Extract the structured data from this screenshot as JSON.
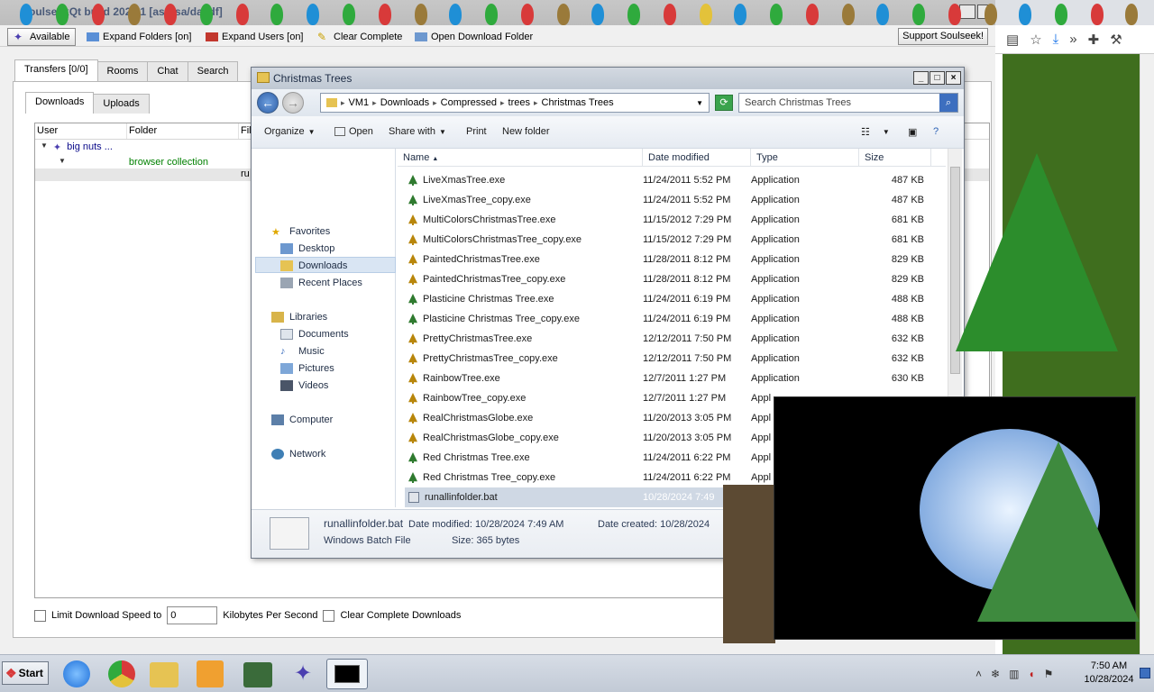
{
  "soulseek": {
    "title": "SoulseekQt build 2024.1 [asdfsa/dasdf]",
    "toolbar": {
      "available": "Available",
      "expand_folders": "Expand Folders [on]",
      "expand_users": "Expand Users [on]",
      "clear_complete": "Clear Complete",
      "open_download_folder": "Open Download Folder",
      "support": "Support Soulseek!"
    },
    "tabs": [
      "Transfers [0/0]",
      "Rooms",
      "Chat",
      "Search"
    ],
    "subtabs": [
      "Downloads",
      "Uploads"
    ],
    "columns": [
      "User",
      "Folder",
      "Fil"
    ],
    "rows": {
      "user": "big nuts ...",
      "folder": "browser collection",
      "file_fragment": "ru"
    },
    "bottom": {
      "limit_label": "Limit Download Speed to",
      "speed_value": "0",
      "units": "Kilobytes Per Second",
      "clear_label": "Clear Complete Downloads"
    }
  },
  "explorer": {
    "title": "Christmas Trees",
    "breadcrumb": [
      "VM1",
      "Downloads",
      "Compressed",
      "trees",
      "Christmas Trees"
    ],
    "search_placeholder": "Search Christmas Trees",
    "commands": {
      "organize": "Organize",
      "open": "Open",
      "share_with": "Share with",
      "print": "Print",
      "new_folder": "New folder"
    },
    "nav": {
      "favorites": "Favorites",
      "desktop": "Desktop",
      "downloads": "Downloads",
      "recent": "Recent Places",
      "libraries": "Libraries",
      "documents": "Documents",
      "music": "Music",
      "pictures": "Pictures",
      "videos": "Videos",
      "computer": "Computer",
      "network": "Network"
    },
    "columns": {
      "name": "Name",
      "date": "Date modified",
      "type": "Type",
      "size": "Size"
    },
    "files": [
      {
        "name": "LiveXmasTree.exe",
        "date": "11/24/2011 5:52 PM",
        "type": "Application",
        "size": "487 KB"
      },
      {
        "name": "LiveXmasTree_copy.exe",
        "date": "11/24/2011 5:52 PM",
        "type": "Application",
        "size": "487 KB"
      },
      {
        "name": "MultiColorsChristmasTree.exe",
        "date": "11/15/2012 7:29 PM",
        "type": "Application",
        "size": "681 KB"
      },
      {
        "name": "MultiColorsChristmasTree_copy.exe",
        "date": "11/15/2012 7:29 PM",
        "type": "Application",
        "size": "681 KB"
      },
      {
        "name": "PaintedChristmasTree.exe",
        "date": "11/28/2011 8:12 PM",
        "type": "Application",
        "size": "829 KB"
      },
      {
        "name": "PaintedChristmasTree_copy.exe",
        "date": "11/28/2011 8:12 PM",
        "type": "Application",
        "size": "829 KB"
      },
      {
        "name": "Plasticine Christmas Tree.exe",
        "date": "11/24/2011 6:19 PM",
        "type": "Application",
        "size": "488 KB"
      },
      {
        "name": "Plasticine Christmas Tree_copy.exe",
        "date": "11/24/2011 6:19 PM",
        "type": "Application",
        "size": "488 KB"
      },
      {
        "name": "PrettyChristmasTree.exe",
        "date": "12/12/2011 7:50 PM",
        "type": "Application",
        "size": "632 KB"
      },
      {
        "name": "PrettyChristmasTree_copy.exe",
        "date": "12/12/2011 7:50 PM",
        "type": "Application",
        "size": "632 KB"
      },
      {
        "name": "RainbowTree.exe",
        "date": "12/7/2011 1:27 PM",
        "type": "Application",
        "size": "630 KB"
      },
      {
        "name": "RainbowTree_copy.exe",
        "date": "12/7/2011 1:27 PM",
        "type": "Appl",
        "size": ""
      },
      {
        "name": "RealChristmasGlobe.exe",
        "date": "11/20/2013 3:05 PM",
        "type": "Appl",
        "size": ""
      },
      {
        "name": "RealChristmasGlobe_copy.exe",
        "date": "11/20/2013 3:05 PM",
        "type": "Appl",
        "size": ""
      },
      {
        "name": "Red Christmas Tree.exe",
        "date": "11/24/2011 6:22 PM",
        "type": "Appl",
        "size": ""
      },
      {
        "name": "Red Christmas Tree_copy.exe",
        "date": "11/24/2011 6:22 PM",
        "type": "Appl",
        "size": ""
      },
      {
        "name": "runallinfolder.bat",
        "date": "10/28/2024 7:49",
        "type": "",
        "size": ""
      }
    ],
    "details": {
      "name": "runallinfolder.bat",
      "modified": "Date modified: 10/28/2024 7:49 AM",
      "created": "Date created: 10/28/2024",
      "type": "Windows Batch File",
      "size": "Size: 365 bytes"
    }
  },
  "taskbar": {
    "start": "Start",
    "time": "7:50 AM",
    "date": "10/28/2024"
  }
}
